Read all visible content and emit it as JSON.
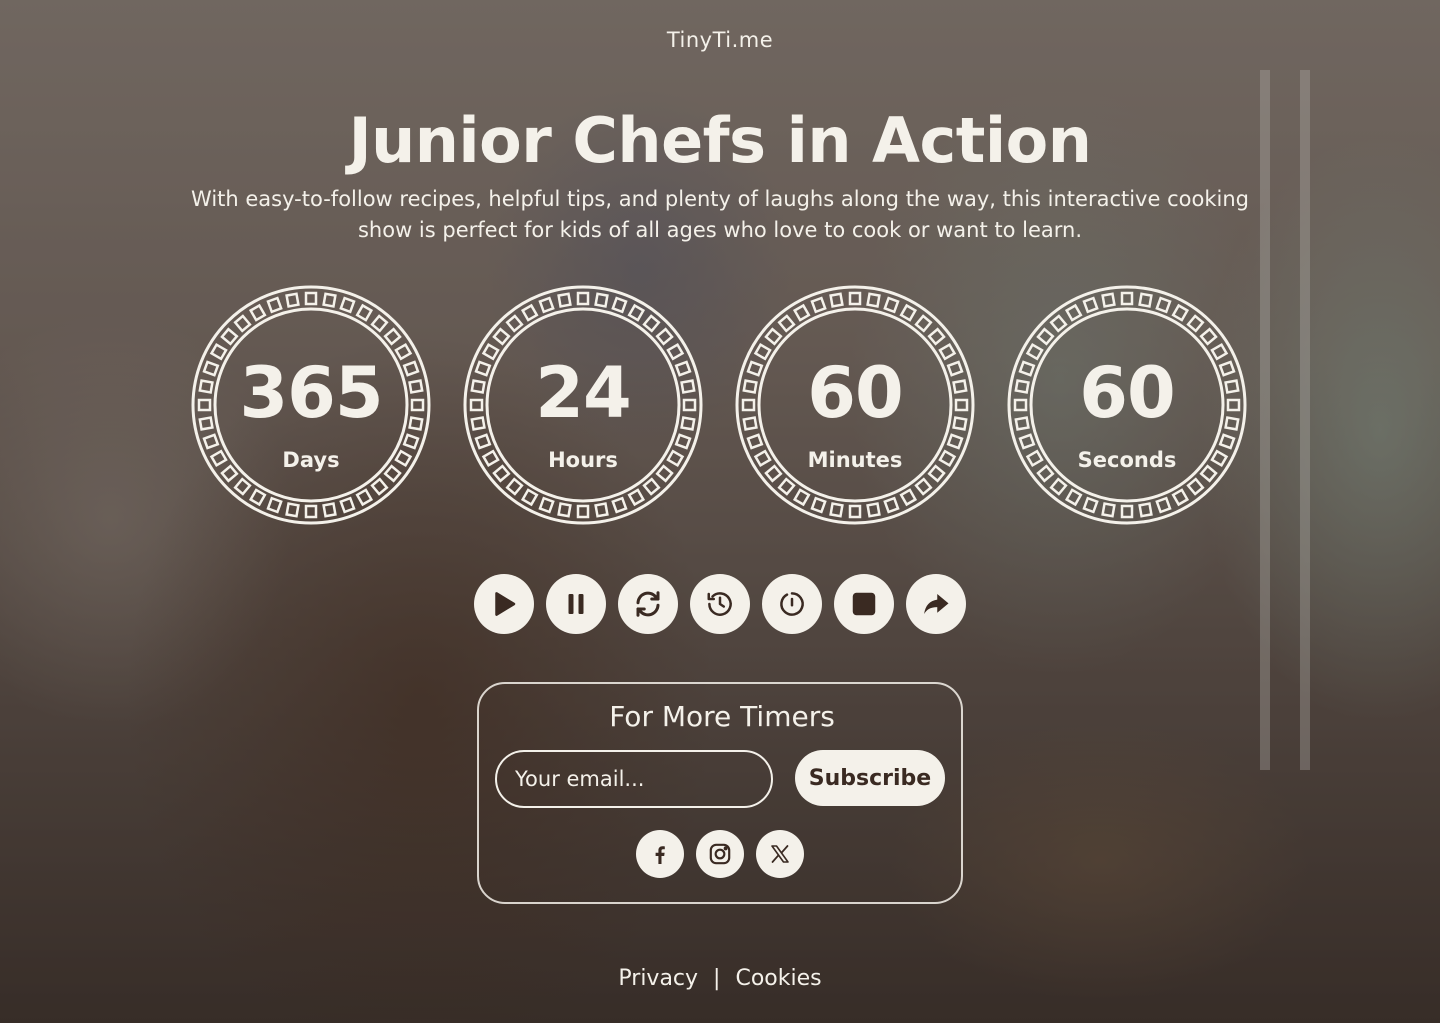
{
  "brand": "TinyTi.me",
  "title": "Junior Chefs in Action",
  "subtitle": "With easy-to-follow recipes, helpful tips, and plenty of laughs along the way, this interactive cooking show is perfect for kids of all ages who love to cook or want to learn.",
  "timers": [
    {
      "value": "365",
      "label": "Days"
    },
    {
      "value": "24",
      "label": "Hours"
    },
    {
      "value": "60",
      "label": "Minutes"
    },
    {
      "value": "60",
      "label": "Seconds"
    }
  ],
  "controls": [
    "play-icon",
    "pause-icon",
    "refresh-icon",
    "history-icon",
    "timer-reset-icon",
    "stop-icon",
    "share-icon"
  ],
  "subscribe": {
    "title": "For More Timers",
    "email_placeholder": "Your email...",
    "button_label": "Subscribe"
  },
  "socials": [
    "facebook-icon",
    "instagram-icon",
    "x-icon"
  ],
  "footer": {
    "privacy": "Privacy",
    "separator": "|",
    "cookies": "Cookies"
  },
  "colors": {
    "foreground": "#f4f1ea",
    "icon_dark": "#3a2a22"
  }
}
